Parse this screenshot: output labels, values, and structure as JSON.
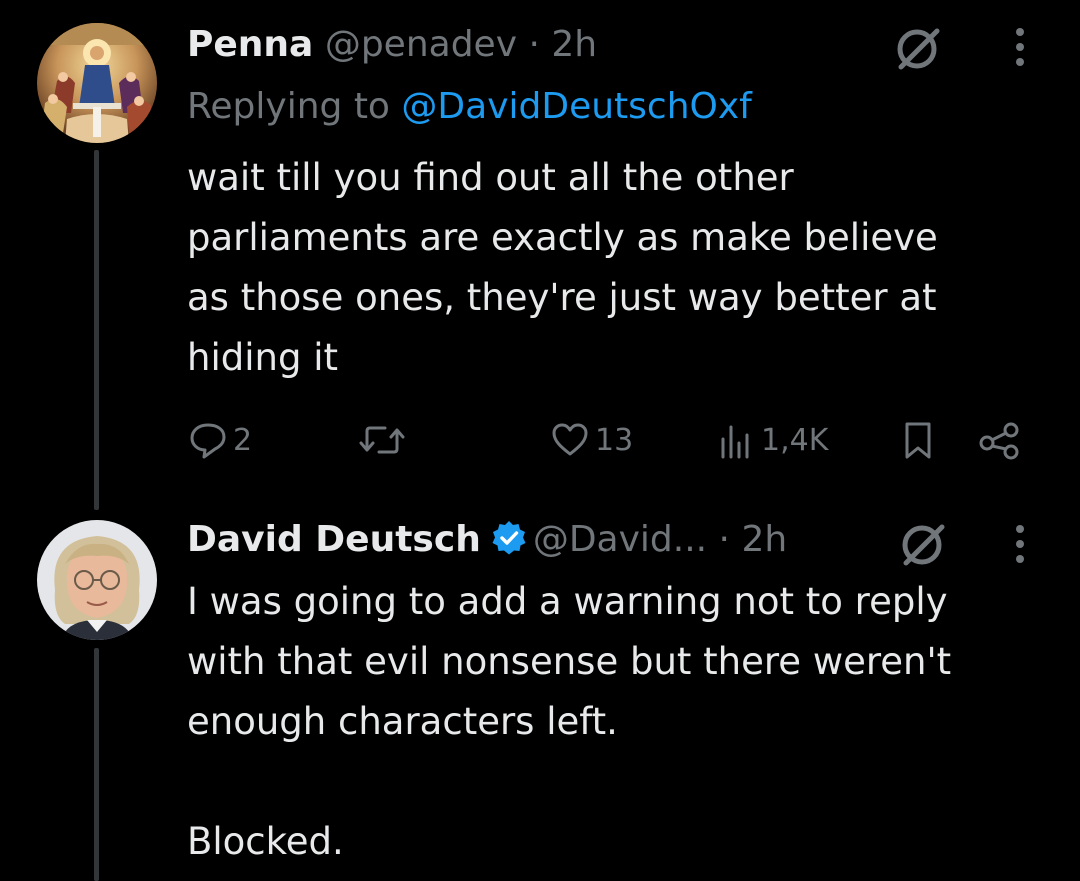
{
  "tweets": [
    {
      "author": {
        "display_name": "Penna",
        "handle": "@penadev",
        "verified": false
      },
      "separator": " · ",
      "time": "2h",
      "replying_to_prefix": "Replying to ",
      "replying_to_handle": "@DavidDeutschOxf",
      "text": "wait till you find out all the other\nparliaments are exactly as make believe\nas those ones, they're just way better at\nhiding it",
      "stats": {
        "replies": "2",
        "retweets": "",
        "likes": "13",
        "views": "1,4K"
      }
    },
    {
      "author": {
        "display_name": "David Deutsch",
        "handle": "@David...",
        "verified": true
      },
      "separator": " · ",
      "time": "2h",
      "text": "I was going to add a warning not to reply\nwith that evil nonsense but there weren't\nenough characters left.\n\nBlocked."
    }
  ],
  "colors": {
    "background": "#000000",
    "primary_text": "#e7e9ea",
    "secondary_text": "#71767b",
    "link": "#1d9bf0",
    "verified_badge": "#1d9bf0",
    "thread_line": "#333639"
  },
  "icons": {
    "reply": "reply-icon",
    "retweet": "retweet-icon",
    "like": "heart-icon",
    "views": "views-icon",
    "bookmark": "bookmark-icon",
    "share": "share-icon",
    "grok": "grok-icon",
    "more": "more-icon",
    "verified": "verified-badge-icon"
  }
}
